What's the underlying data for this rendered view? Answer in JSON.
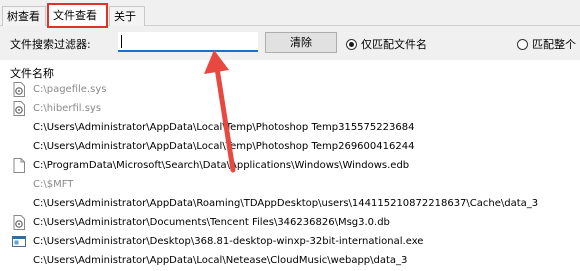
{
  "tabs": {
    "tree_view": "树查看",
    "file_view": "文件查看",
    "about": "关于"
  },
  "filter": {
    "label": "文件搜索过滤器:",
    "value": "",
    "clear_button": "清除",
    "radio_filename_only": "仅匹配文件名",
    "radio_full_path": "匹配整个"
  },
  "list": {
    "header": "文件名称",
    "rows": [
      {
        "path": "C:\\pagefile.sys",
        "icon": "system-file-icon"
      },
      {
        "path": "C:\\hiberfil.sys",
        "icon": "system-file-icon"
      },
      {
        "path": "C:\\Users\\Administrator\\AppData\\Local\\Temp\\Photoshop Temp315575223684",
        "icon": ""
      },
      {
        "path": "C:\\Users\\Administrator\\AppData\\Local\\Temp\\Photoshop Temp269600416244",
        "icon": ""
      },
      {
        "path": "C:\\ProgramData\\Microsoft\\Search\\Data\\Applications\\Windows\\Windows.edb",
        "icon": "blank-file-icon"
      },
      {
        "path": "C:\\$MFT",
        "icon": ""
      },
      {
        "path": "C:\\Users\\Administrator\\AppData\\Roaming\\TDAppDesktop\\users\\144115210872218637\\Cache\\data_3",
        "icon": ""
      },
      {
        "path": "C:\\Users\\Administrator\\Documents\\Tencent Files\\346236826\\Msg3.0.db",
        "icon": "system-file-icon"
      },
      {
        "path": "C:\\Users\\Administrator\\Desktop\\368.81-desktop-winxp-32bit-international.exe",
        "icon": "exe-file-icon"
      },
      {
        "path": "C:\\Users\\Administrator\\AppData\\Local\\Netease\\CloudMusic\\webapp\\data_3",
        "icon": ""
      }
    ]
  },
  "colors": {
    "highlight_red": "#e0312a",
    "input_underline": "#1e6fc9"
  }
}
